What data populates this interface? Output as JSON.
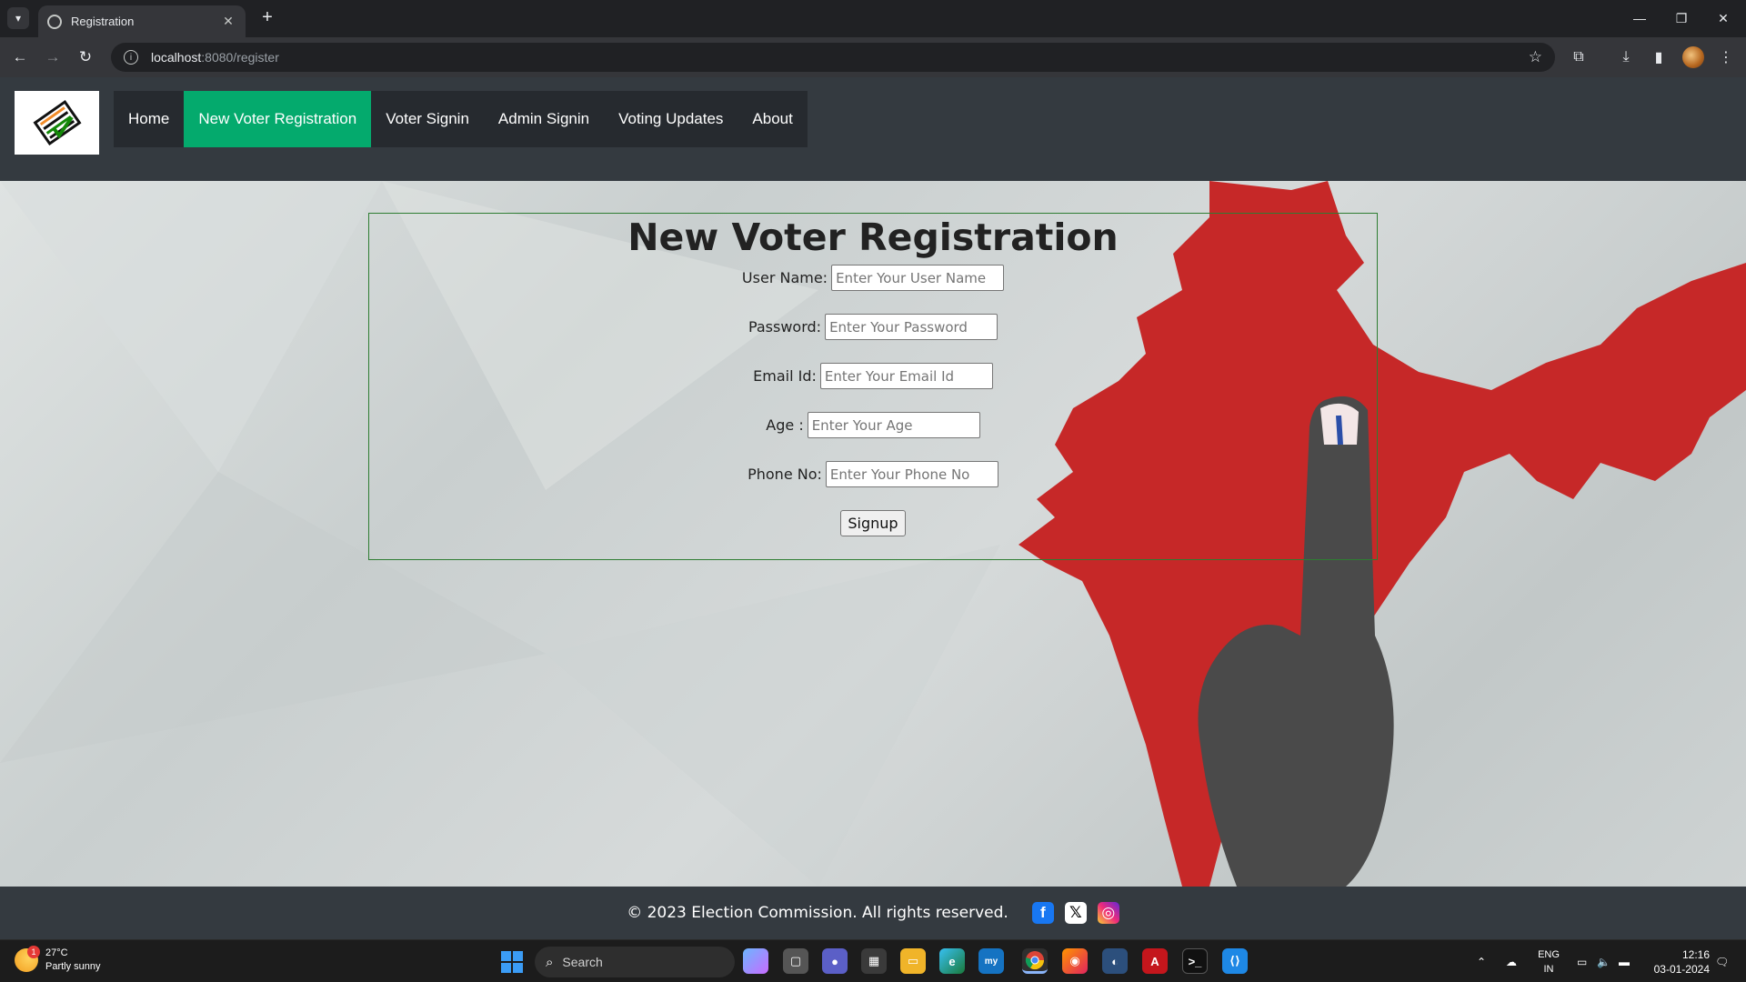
{
  "browser": {
    "tab_title": "Registration",
    "url_host": "localhost",
    "url_path": ":8080/register"
  },
  "nav": {
    "items": [
      {
        "label": "Home",
        "active": false
      },
      {
        "label": "New Voter Registration",
        "active": true
      },
      {
        "label": "Voter Signin",
        "active": false
      },
      {
        "label": "Admin Signin",
        "active": false
      },
      {
        "label": "Voting Updates",
        "active": false
      },
      {
        "label": "About",
        "active": false
      }
    ],
    "active_color": "#04aa6d",
    "header_color": "#343a40"
  },
  "form": {
    "title": "New Voter Registration",
    "fields": [
      {
        "label": "User Name:",
        "placeholder": "Enter Your User Name"
      },
      {
        "label": "Password:",
        "placeholder": "Enter Your Password"
      },
      {
        "label": "Email Id:",
        "placeholder": "Enter Your Email Id"
      },
      {
        "label": "Age :",
        "placeholder": "Enter Your Age"
      },
      {
        "label": "Phone No:",
        "placeholder": "Enter Your Phone No"
      }
    ],
    "submit_label": "Signup"
  },
  "footer": {
    "text": "© 2023 Election Commission. All rights reserved.",
    "social_icons": [
      "facebook-icon",
      "x-icon",
      "instagram-icon"
    ]
  },
  "taskbar": {
    "weather_temp": "27°C",
    "weather_desc": "Partly sunny",
    "weather_badge": "1",
    "search_label": "Search",
    "lang_top": "ENG",
    "lang_bottom": "IN",
    "time": "12:16",
    "date": "03-01-2024"
  }
}
